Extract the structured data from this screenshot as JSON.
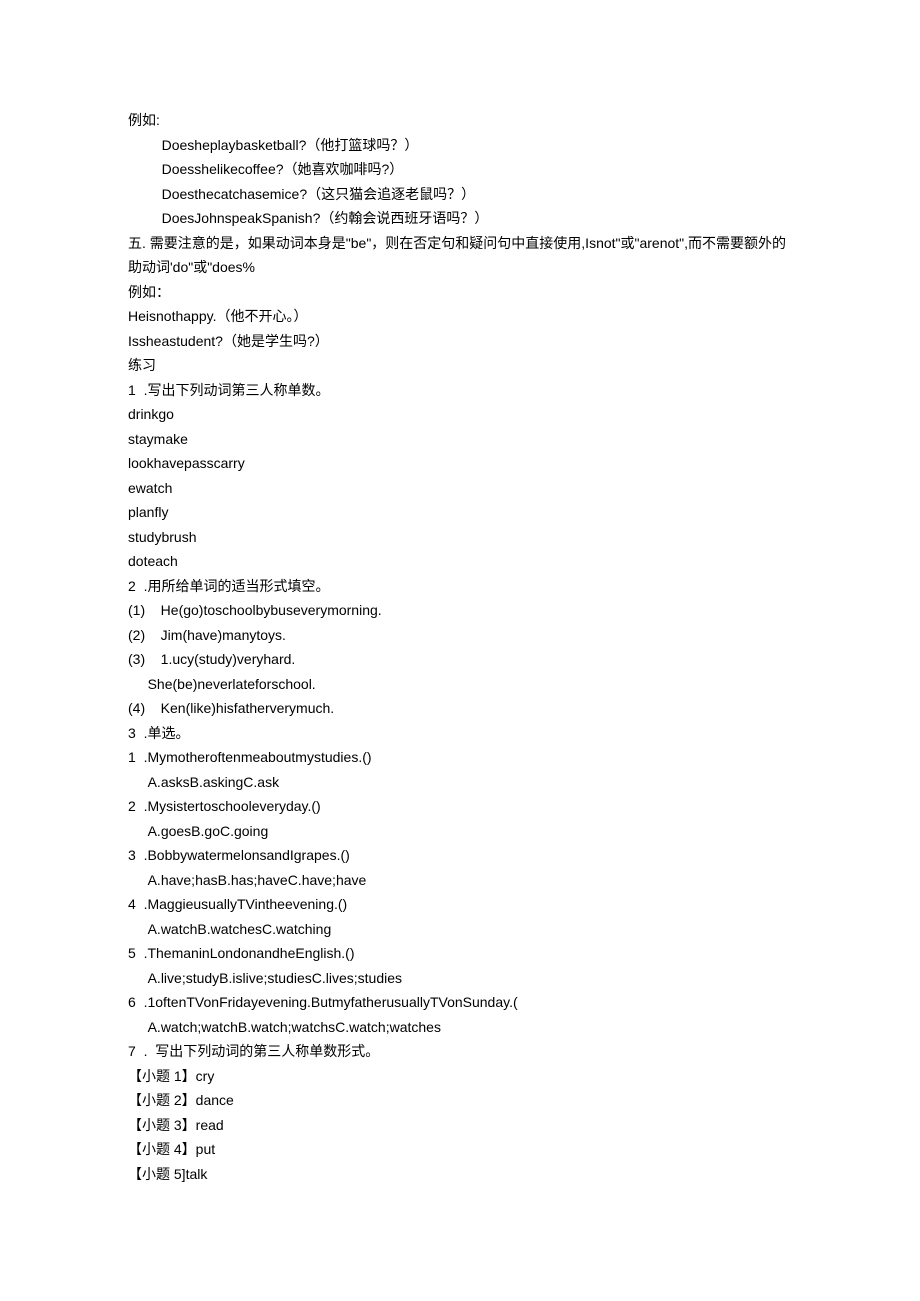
{
  "lines": [
    {
      "text": "例如:",
      "indent": 0
    },
    {
      "text": "Doesheplaybasketball?（他打篮球吗？）",
      "indent": 2
    },
    {
      "text": "Doesshelikecoffee?（她喜欢咖啡吗?）",
      "indent": 2
    },
    {
      "text": "Doesthecatchasemice?（这只猫会追逐老鼠吗？）",
      "indent": 2
    },
    {
      "text": "DoesJohnspeakSpanish?（约翰会说西班牙语吗？）",
      "indent": 2
    },
    {
      "text": "五. 需要注意的是，如果动词本身是\"be\"，则在否定句和疑问句中直接使用,Isnot\"或\"arenot\",而不需要额外的助动词'do\"或\"does%",
      "indent": 0
    },
    {
      "text": "例如：",
      "indent": 0
    },
    {
      "text": "Heisnothappy.（他不开心。）",
      "indent": 0
    },
    {
      "text": "Issheastudent?（她是学生吗?）",
      "indent": 0
    },
    {
      "text": "练习",
      "indent": 0
    },
    {
      "text": "1  .写出下列动词第三人称单数。",
      "indent": 0
    },
    {
      "text": "drinkgo",
      "indent": 0
    },
    {
      "text": "staymake",
      "indent": 0
    },
    {
      "text": "lookhavepasscarry",
      "indent": 0
    },
    {
      "text": "ewatch",
      "indent": 0
    },
    {
      "text": "planfly",
      "indent": 0
    },
    {
      "text": "studybrush",
      "indent": 0
    },
    {
      "text": "doteach",
      "indent": 0
    },
    {
      "text": "2  .用所给单词的适当形式填空。",
      "indent": 0
    },
    {
      "text": "(1)    He(go)toschoolbybuseverymorning.",
      "indent": 0
    },
    {
      "text": "(2)    Jim(have)manytoys.",
      "indent": 0
    },
    {
      "text": "(3)    1.ucy(study)veryhard.",
      "indent": 0
    },
    {
      "text": "She(be)neverlateforschool.",
      "indent": 1
    },
    {
      "text": "(4)    Ken(like)hisfatherverymuch.",
      "indent": 0
    },
    {
      "text": "3  .单选。",
      "indent": 0
    },
    {
      "text": "1  .Mymotheroftenmeaboutmystudies.()",
      "indent": 0
    },
    {
      "text": "A.asksB.askingC.ask",
      "indent": 1
    },
    {
      "text": "2  .Mysistertoschooleveryday.()",
      "indent": 0
    },
    {
      "text": "A.goesB.goC.going",
      "indent": 1
    },
    {
      "text": "3  .BobbywatermelonsandIgrapes.()",
      "indent": 0
    },
    {
      "text": "A.have;hasB.has;haveC.have;have",
      "indent": 1
    },
    {
      "text": "4  .MaggieusuallyTVintheevening.()",
      "indent": 0
    },
    {
      "text": "A.watchB.watchesC.watching",
      "indent": 1
    },
    {
      "text": "5  .ThemaninLondonandheEnglish.()",
      "indent": 0
    },
    {
      "text": "A.live;studyB.islive;studiesC.lives;studies",
      "indent": 1
    },
    {
      "text": "6  .1oftenTVonFridayevening.ButmyfatherusuallyTVonSunday.(",
      "indent": 0
    },
    {
      "text": "A.watch;watchB.watch;watchsC.watch;watches",
      "indent": 1
    },
    {
      "text": "7  .  写出下列动词的第三人称单数形式。",
      "indent": 0
    },
    {
      "text": "【小题 1】cry",
      "indent": 0
    },
    {
      "text": "【小题 2】dance",
      "indent": 0
    },
    {
      "text": "【小题 3】read",
      "indent": 0
    },
    {
      "text": "【小题 4】put",
      "indent": 0
    },
    {
      "text": "【小题 5]talk",
      "indent": 0
    }
  ]
}
